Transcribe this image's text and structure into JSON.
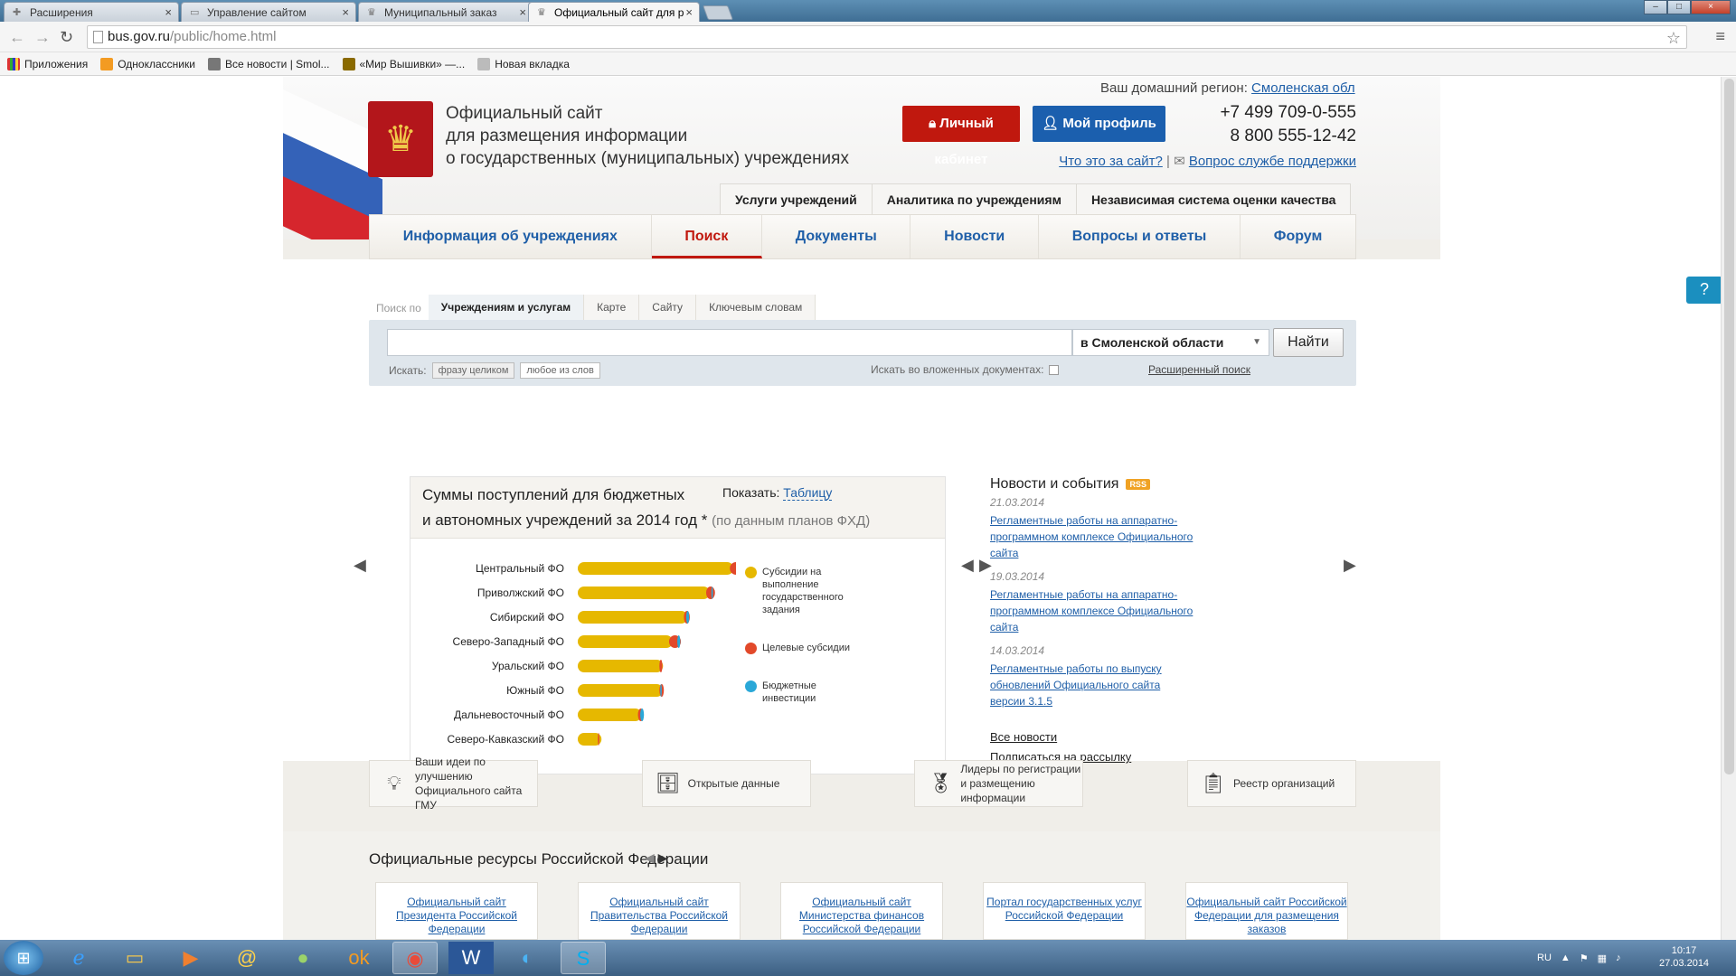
{
  "browser": {
    "tabs": [
      {
        "title": "Расширения",
        "icon": "puzzle-icon"
      },
      {
        "title": "Управление сайтом",
        "icon": "page-icon"
      },
      {
        "title": "Муниципальный заказ",
        "icon": "emblem-icon"
      },
      {
        "title": "Официальный сайт для р",
        "icon": "emblem-icon",
        "active": true
      }
    ],
    "url_prefix": "bus.gov.ru",
    "url_path": "/public/home.html",
    "bookmarks": [
      {
        "label": "Приложения",
        "icon": "apps-grid-icon",
        "color": "#cc3333"
      },
      {
        "label": "Одноклассники",
        "icon": "ok-icon",
        "color": "#f39b22"
      },
      {
        "label": "Все новости | Smol...",
        "icon": "news-icon",
        "color": "#777777"
      },
      {
        "label": "«Мир Вышивки» —...",
        "icon": "stitch-icon",
        "color": "#8a6a00"
      },
      {
        "label": "Новая вкладка",
        "icon": "grid-icon",
        "color": "#777777"
      }
    ]
  },
  "header": {
    "region_label": "Ваш домашний регион:",
    "region_value": "Смоленская обл",
    "title_line1": "Официальный сайт",
    "title_line2": "для размещения информации",
    "title_line3": "о государственных (муниципальных) учреждениях",
    "cabinet_label": "Личный кабинет",
    "profile_label": "Мой профиль",
    "phone1": "+7 499 709-0-555",
    "phone2": "8 800 555-12-42",
    "about_link": "Что это за сайт?",
    "support_link": "Вопрос службе поддержки",
    "top_tabs": [
      "Услуги учреждений",
      "Аналитика по учреждениям",
      "Независимая система оценки качества"
    ],
    "nav": [
      "Информация об учреждениях",
      "Поиск",
      "Документы",
      "Новости",
      "Вопросы и ответы",
      "Форум"
    ],
    "nav_active": "Поиск"
  },
  "search": {
    "label": "Поиск по",
    "tabs": [
      "Учреждениям и услугам",
      "Карте",
      "Сайту",
      "Ключевым словам"
    ],
    "active_tab": "Учреждениям и услугам",
    "input_value": "",
    "region_select": "в Смоленской области",
    "find_button": "Найти",
    "search_label": "Искать:",
    "mode_phrase": "фразу целиком",
    "mode_any": "любое из слов",
    "nested_label": "Искать во вложенных документах:",
    "advanced_link": "Расширенный поиск"
  },
  "chart_panel": {
    "title_line1": "Суммы поступлений для бюджетных",
    "title_line2": "и автономных учреждений за 2014 год *",
    "note": "(по данным планов ФХД)",
    "show_label": "Показать:",
    "show_link": "Таблицу"
  },
  "chart_data": {
    "type": "bar",
    "categories": [
      "Центральный ФО",
      "Приволжский ФО",
      "Сибирский ФО",
      "Северо-Западный ФО",
      "Уральский ФО",
      "Южный ФО",
      "Дальневосточный ФО",
      "Северо-Кавказский ФО"
    ],
    "series": [
      {
        "name": "Субсидии на выполнение государственного задания",
        "color": "#e6b800",
        "values": [
          210,
          178,
          148,
          128,
          115,
          115,
          86,
          32
        ]
      },
      {
        "name": "Целевые субсидии",
        "color": "#e2492a",
        "values": [
          18,
          12,
          8,
          16,
          4,
          6,
          8,
          2
        ]
      },
      {
        "name": "Бюджетные инвестиции",
        "color": "#2aa8d8",
        "values": [
          4,
          2,
          4,
          4,
          0,
          2,
          5,
          0
        ]
      }
    ],
    "legend_position": "right"
  },
  "legend": [
    {
      "label": "Субсидии на выполнение государственного задания",
      "color": "#e6b800"
    },
    {
      "label": "Целевые субсидии",
      "color": "#e2492a"
    },
    {
      "label": "Бюджетные инвестиции",
      "color": "#2aa8d8"
    }
  ],
  "news": {
    "title": "Новости и события",
    "rss": "RSS",
    "items": [
      {
        "date": "21.03.2014",
        "text": "Регламентные работы на аппаратно-программном комплексе Официального сайта"
      },
      {
        "date": "19.03.2014",
        "text": "Регламентные работы на аппаратно-программном комплексе Официального сайта"
      },
      {
        "date": "14.03.2014",
        "text": "Регламентные работы по выпуску обновлений Официального сайта версии 3.1.5"
      }
    ],
    "all_news": "Все новости",
    "subscribe": "Подписаться на рассылку"
  },
  "features": [
    {
      "label": "Ваши идеи по улучшению Официального сайта ГМУ",
      "icon": "lightbulb-icon"
    },
    {
      "label": "Открытые данные",
      "icon": "database-icon"
    },
    {
      "label": "Лидеры по регистрации и размещению информации",
      "icon": "medal-icon"
    },
    {
      "label": "Реестр организаций",
      "icon": "registry-icon"
    }
  ],
  "resources": {
    "title": "Официальные ресурсы Российской Федерации",
    "cards": [
      "Официальный сайт Президента Российской Федерации",
      "Официальный сайт Правительства Российской Федерации",
      "Официальный сайт Министерства финансов Российской Федерации",
      "Портал государственных услуг Российской Федерации",
      "Официальный сайт Российской Федерации для размещения заказов"
    ]
  },
  "taskbar": {
    "lang": "RU",
    "time": "10:17",
    "date": "27.03.2014",
    "apps": [
      "ie-icon",
      "explorer-icon",
      "media-player-icon",
      "mail-icon",
      "sphere-icon",
      "odnoklassniki-icon",
      "chrome-icon",
      "word-icon",
      "app-icon",
      "skype-icon"
    ]
  }
}
